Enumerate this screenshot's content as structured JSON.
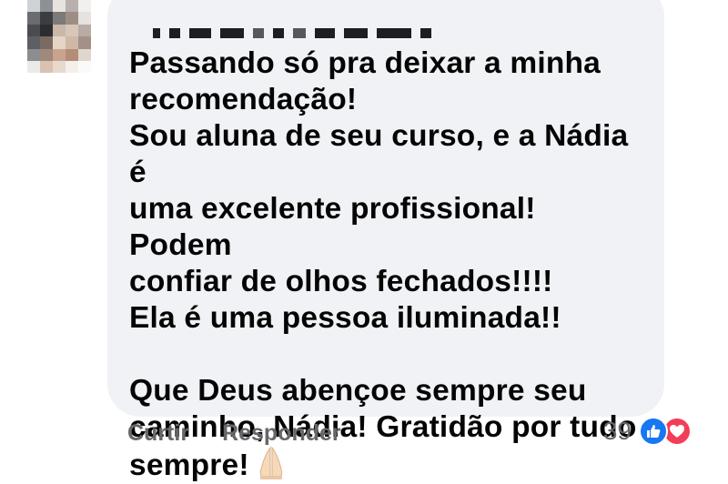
{
  "comment": {
    "author_name": "",
    "text": "Passando só pra deixar a minha\nrecomendação!\nSou aluna de seu curso, e a Nádia é\numa excelente profissional! Podem\nconfiar de olhos fechados!!!!\nEla é uma pessoa iluminada!!\n\nQue Deus abençoe sempre seu\ncaminho, Nádia! Gratidão por tudo\nsempre!",
    "trailing_emoji": "folded-hands-icon"
  },
  "actions": {
    "like_label": "Curtir",
    "reply_label": "Responder"
  },
  "reactions": {
    "count": "39",
    "types": [
      "like-icon",
      "love-icon"
    ],
    "colors": {
      "like": "#1877f2",
      "love": "#f33e58"
    }
  },
  "theme": {
    "bubble_bg": "#f0f2f5",
    "text": "#050505",
    "muted": "#65676b"
  }
}
